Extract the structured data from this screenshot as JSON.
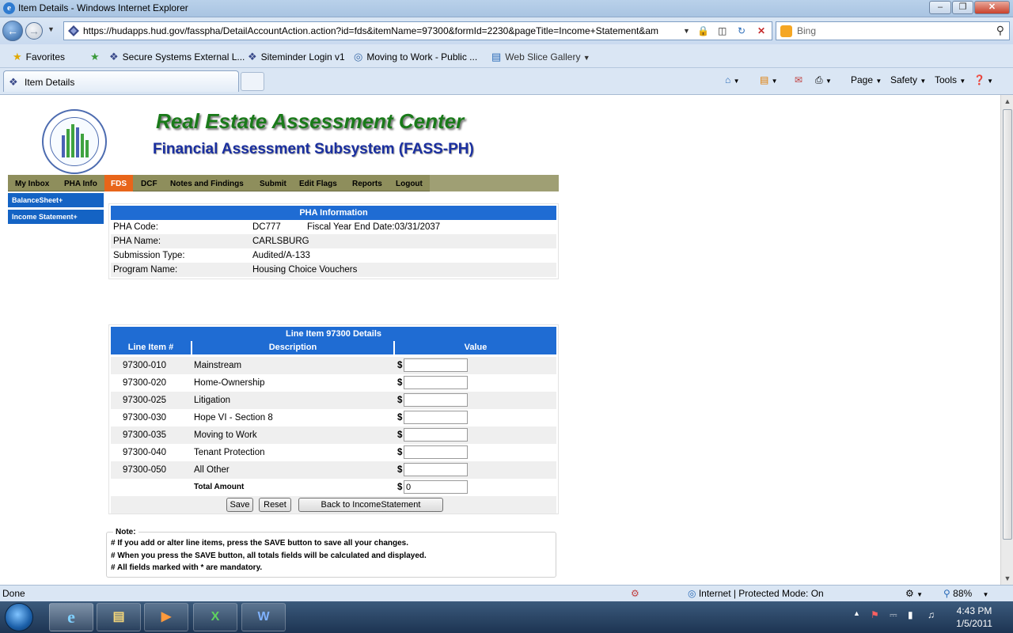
{
  "window": {
    "title": "Item Details - Windows Internet Explorer",
    "url": "https://hudapps.hud.gov/fasspha/DetailAccountAction.action?id=fds&itemName=97300&formId=2230&pageTitle=Income+Statement&am",
    "search_placeholder": "Bing"
  },
  "favorites": {
    "label": "Favorites",
    "items": [
      "Secure Systems External L...",
      "Siteminder Login v1",
      "Moving to Work - Public ...",
      "Web Slice Gallery"
    ]
  },
  "tab": {
    "label": "Item Details"
  },
  "commandbar": {
    "page": "Page",
    "safety": "Safety",
    "tools": "Tools"
  },
  "header": {
    "reac_title": "Real Estate Assessment Center",
    "fass_title": "Financial Assessment Subsystem (FASS-PH)"
  },
  "topnav": [
    "My Inbox",
    "PHA Info",
    "FDS",
    "DCF",
    "Notes and Findings",
    "Submit",
    "Edit Flags",
    "Reports",
    "Logout"
  ],
  "sidenav": [
    "BalanceSheet+",
    "Income Statement+"
  ],
  "pha_info": {
    "heading": "PHA Information",
    "code_label": "PHA Code:",
    "code": "DC777",
    "fiscal_year_end": "Fiscal Year End Date:03/31/2037",
    "name_label": "PHA Name:",
    "name": "CARLSBURG",
    "submission_label": "Submission Type:",
    "submission": "Audited/A-133",
    "program_label": "Program Name:",
    "program": "Housing Choice Vouchers"
  },
  "line_item": {
    "heading": "Line Item 97300 Details",
    "col_line": "Line Item #",
    "col_desc": "Description",
    "col_value": "Value",
    "rows": [
      {
        "code": "97300-010",
        "desc": "Mainstream",
        "value": ""
      },
      {
        "code": "97300-020",
        "desc": "Home-Ownership",
        "value": ""
      },
      {
        "code": "97300-025",
        "desc": "Litigation",
        "value": ""
      },
      {
        "code": "97300-030",
        "desc": "Hope VI - Section 8",
        "value": ""
      },
      {
        "code": "97300-035",
        "desc": "Moving to Work",
        "value": ""
      },
      {
        "code": "97300-040",
        "desc": "Tenant Protection",
        "value": ""
      },
      {
        "code": "97300-050",
        "desc": "All Other",
        "value": ""
      }
    ],
    "total_label": "Total Amount",
    "total_value": "0",
    "currency": "$",
    "save": "Save",
    "reset": "Reset",
    "back": "Back to IncomeStatement"
  },
  "note": {
    "legend": "Note:",
    "lines": [
      "# If you add or alter line items, press the SAVE button to save all your changes.",
      "# When you press the SAVE button, all totals fields will be calculated and displayed.",
      "# All fields marked with * are mandatory."
    ]
  },
  "status": {
    "left": "Done",
    "zone": "Internet | Protected Mode: On",
    "zoom": "88%"
  },
  "clock": {
    "time": "4:43 PM",
    "date": "1/5/2011"
  },
  "colors": {
    "nav_bg": "#8e8e5c",
    "nav_active": "#e8651a",
    "panel_head": "#1f6cd3",
    "reac_green": "#1a7a1a",
    "fass_blue": "#1a2fa0"
  }
}
